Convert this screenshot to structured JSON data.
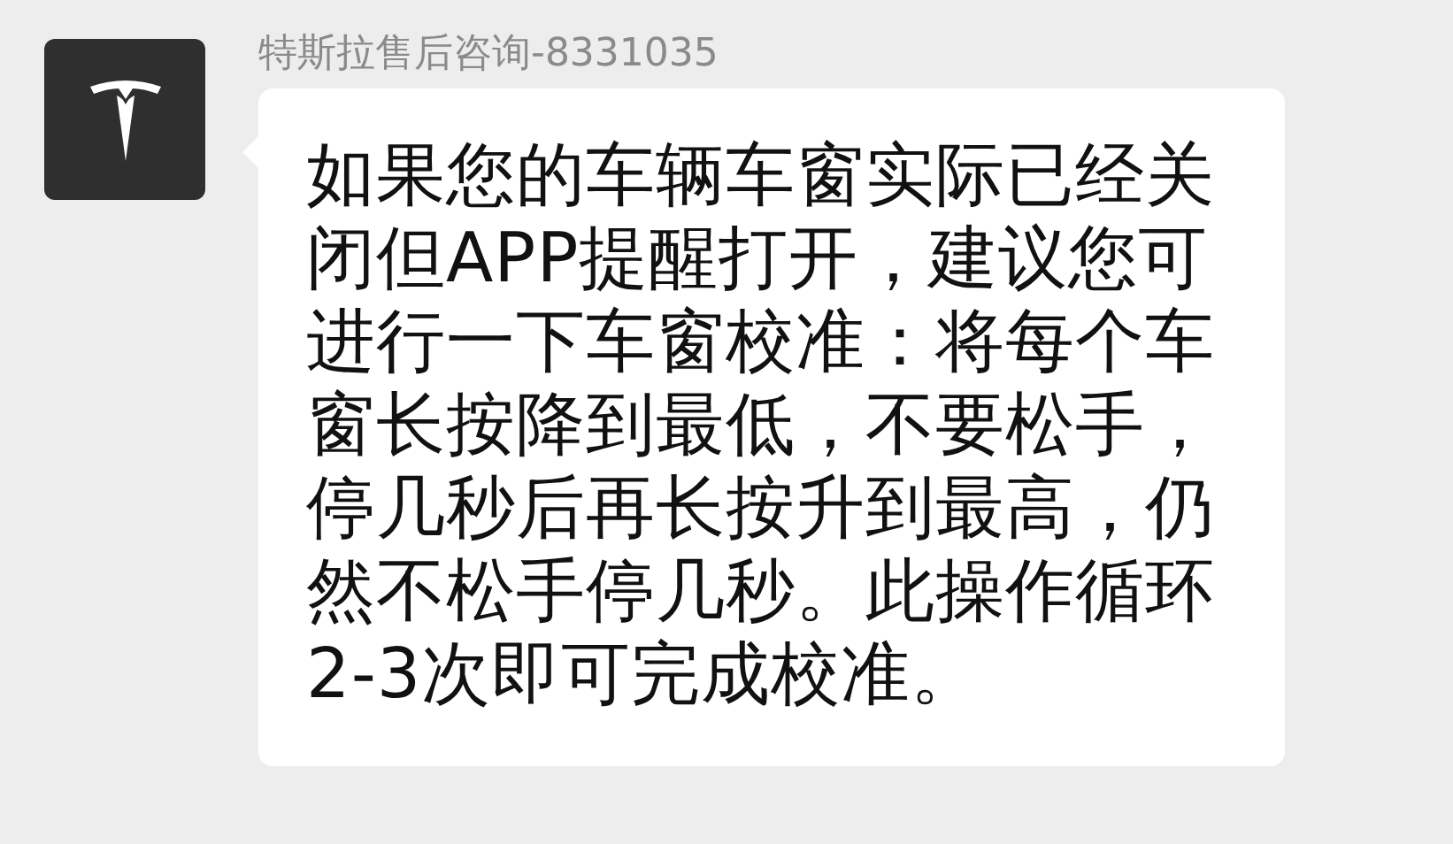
{
  "message": {
    "sender": "特斯拉售后咨询-8331035",
    "text": "如果您的车辆车窗实际已经关闭但APP提醒打开，建议您可进行一下车窗校准：将每个车窗长按降到最低，不要松手，停几秒后再长按升到最高，仍然不松手停几秒。此操作循环2-3次即可完成校准。"
  }
}
